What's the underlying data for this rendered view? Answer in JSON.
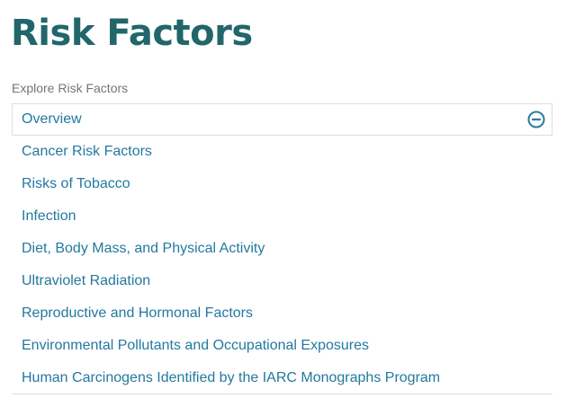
{
  "page": {
    "title": "Risk Factors"
  },
  "nav": {
    "caption": "Explore Risk Factors",
    "items": [
      {
        "label": "Overview",
        "icon": "minus-circle-icon"
      },
      {
        "label": "Cancer Risk Factors"
      },
      {
        "label": "Risks of Tobacco"
      },
      {
        "label": "Infection"
      },
      {
        "label": "Diet, Body Mass, and Physical Activity"
      },
      {
        "label": "Ultraviolet Radiation"
      },
      {
        "label": "Reproductive and Hormonal Factors"
      },
      {
        "label": "Environmental Pollutants and Occupational Exposures"
      },
      {
        "label": "Human Carcinogens Identified by the IARC Monographs Program"
      }
    ]
  },
  "colors": {
    "title": "#21666a",
    "link": "#2379a0",
    "caption": "#757575",
    "border": "#dedede"
  }
}
